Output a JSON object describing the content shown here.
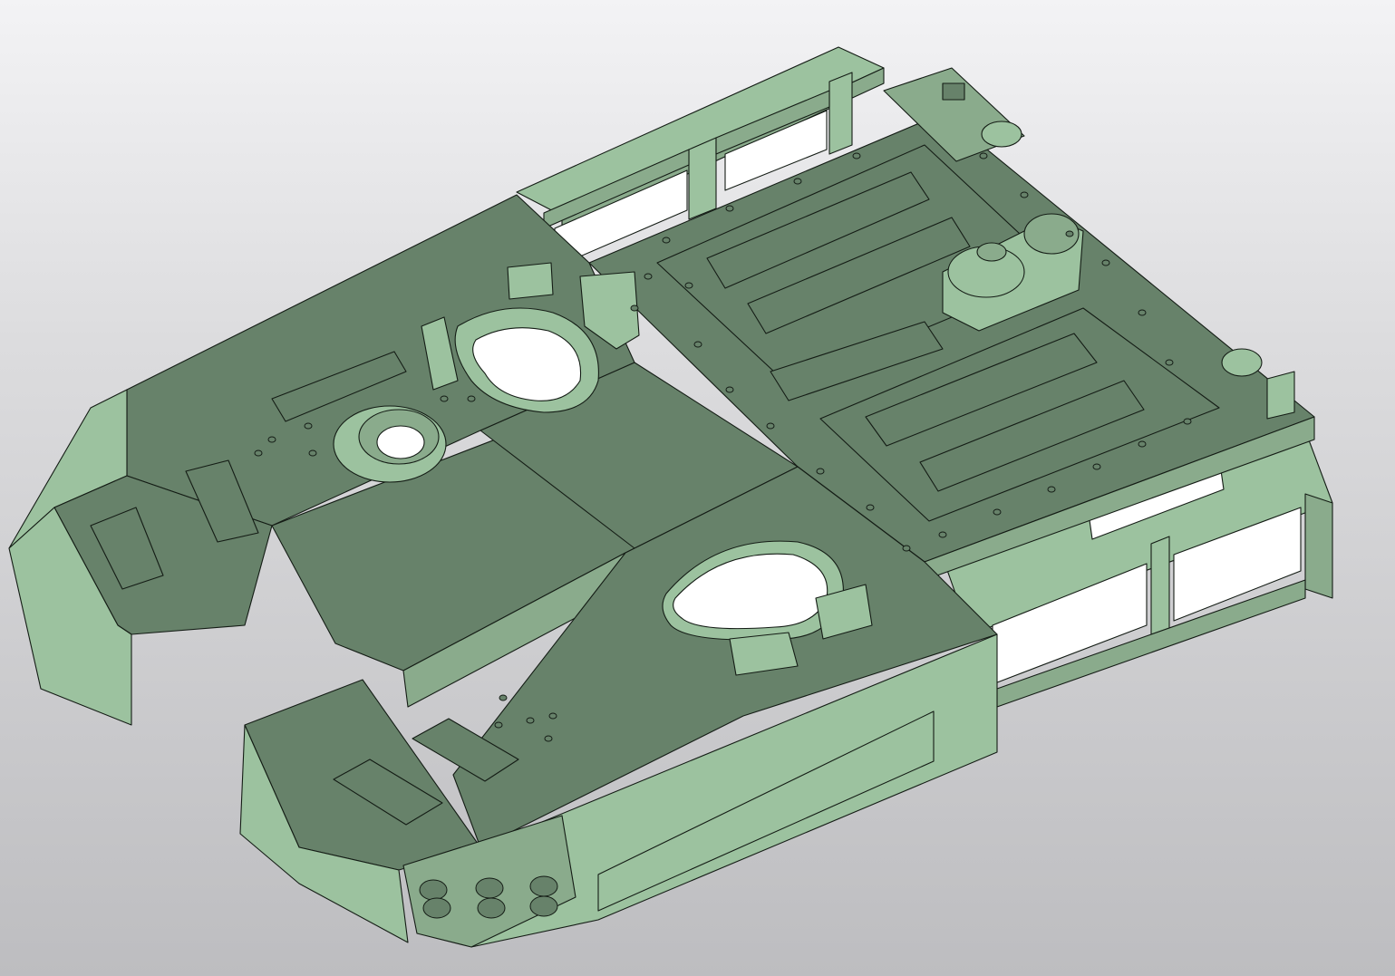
{
  "viewport": {
    "background_top": "#f3f3f5",
    "background_bottom": "#bdbdc0"
  },
  "model": {
    "part_type": "armored-vehicle-hull-floor-assembly",
    "shaded_with_edges": true,
    "colors": {
      "face_light": "#9cc29f",
      "face_mid": "#8aab8c",
      "face_dark": "#67826a",
      "edge": "#141c15",
      "hole_background": "#ffffff"
    },
    "icons": [
      "hatch-opening-icon",
      "turret-ring-icon",
      "drive-housing-icon",
      "mount-bracket-icon",
      "bolt-hole-icon"
    ]
  }
}
